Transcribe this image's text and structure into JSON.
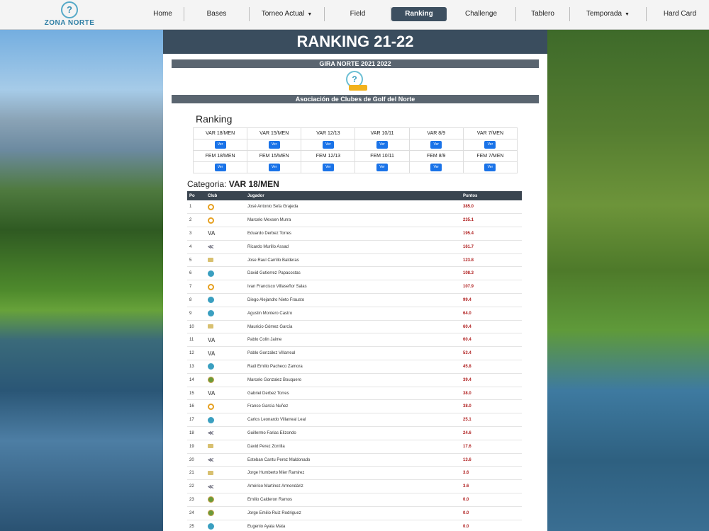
{
  "nav": {
    "logo_text": "ZONA NORTE",
    "items": [
      {
        "label": "Home",
        "dropdown": false,
        "active": false
      },
      {
        "label": "Bases",
        "dropdown": false,
        "active": false
      },
      {
        "label": "Torneo Actual",
        "dropdown": true,
        "active": false
      },
      {
        "label": "Field",
        "dropdown": false,
        "active": false
      },
      {
        "label": "Ranking",
        "dropdown": false,
        "active": true
      },
      {
        "label": "Challenge",
        "dropdown": false,
        "active": false
      },
      {
        "label": "Tablero",
        "dropdown": false,
        "active": false
      },
      {
        "label": "Temporada",
        "dropdown": true,
        "active": false
      },
      {
        "label": "Hard Card",
        "dropdown": false,
        "active": false
      }
    ]
  },
  "page": {
    "title": "RANKING 21-22",
    "subtitle": "GIRA NORTE 2021 2022",
    "association": "Asociación de Clubes de Golf del Norte",
    "ranking_heading": "Ranking",
    "button_label": "Ver"
  },
  "categories": [
    [
      "VAR 18/MEN",
      "VAR 15/MEN",
      "VAR 12/13",
      "VAR 10/11",
      "VAR 8/9",
      "VAR 7/MEN"
    ],
    [
      "FEM 18/MEN",
      "FEM 15/MEN",
      "FEM 12/13",
      "FEM 10/11",
      "FEM 8/9",
      "FEM 7/MEN"
    ]
  ],
  "category": {
    "label": "Categoria:",
    "value": "VAR 18/MEN"
  },
  "table": {
    "headers": [
      "Po",
      "Club",
      "Jugador",
      "Puntos"
    ],
    "rows": [
      {
        "po": "1",
        "club": "o",
        "player": "José Antonio Sefa Grajeda",
        "points": "385.0"
      },
      {
        "po": "2",
        "club": "o",
        "player": "Marcelo Mexsen Murra",
        "points": "235.1"
      },
      {
        "po": "3",
        "club": "v",
        "player": "Eduardo Derbez Torres",
        "points": "195.4"
      },
      {
        "po": "4",
        "club": "k",
        "player": "Ricardo Murillo Assad",
        "points": "161.7"
      },
      {
        "po": "5",
        "club": "y",
        "player": "Jose Raul Carrillo Balderas",
        "points": "123.8"
      },
      {
        "po": "6",
        "club": "b",
        "player": "David Gutierrez Papacostas",
        "points": "108.3"
      },
      {
        "po": "7",
        "club": "o",
        "player": "Ivan Francisco Villaseñor Salas",
        "points": "107.9"
      },
      {
        "po": "8",
        "club": "b",
        "player": "Diego Alejandro Nieto Frausto",
        "points": "99.4"
      },
      {
        "po": "9",
        "club": "b",
        "player": "Agustin Montero Castro",
        "points": "64.0"
      },
      {
        "po": "10",
        "club": "y",
        "player": "Mauricio Gómez García",
        "points": "60.4"
      },
      {
        "po": "11",
        "club": "v",
        "player": "Pablo Colin Jaime",
        "points": "60.4"
      },
      {
        "po": "12",
        "club": "v",
        "player": "Pablo González Villarreal",
        "points": "53.4"
      },
      {
        "po": "13",
        "club": "b",
        "player": "Raúl Emilio Pacheco Zamora",
        "points": "45.8"
      },
      {
        "po": "14",
        "club": "g",
        "player": "Marcelo Gonzalez Bouquero",
        "points": "39.4"
      },
      {
        "po": "15",
        "club": "v",
        "player": "Gabriel Derbez Torres",
        "points": "38.0"
      },
      {
        "po": "16",
        "club": "o",
        "player": "Franco García Nuñez",
        "points": "38.0"
      },
      {
        "po": "17",
        "club": "b",
        "player": "Carlos Leonardo Villarreal Leal",
        "points": "25.1"
      },
      {
        "po": "18",
        "club": "k",
        "player": "Guillermo Farias Elizondo",
        "points": "24.6"
      },
      {
        "po": "19",
        "club": "y",
        "player": "David Perez Zorrilla",
        "points": "17.6"
      },
      {
        "po": "20",
        "club": "k",
        "player": "Esteban Cantu Perez Maldonado",
        "points": "13.6"
      },
      {
        "po": "21",
        "club": "y",
        "player": "Jorge Humberto Mier Ramirez",
        "points": "3.6"
      },
      {
        "po": "22",
        "club": "k",
        "player": "Américo Martinez Armendáriz",
        "points": "3.6"
      },
      {
        "po": "23",
        "club": "g",
        "player": "Emilio Calderon Ramos",
        "points": "0.0"
      },
      {
        "po": "24",
        "club": "g",
        "player": "Jorge Emilio Ruiz Rodriguez",
        "points": "0.0"
      },
      {
        "po": "25",
        "club": "b",
        "player": "Eugenio Ayala Mata",
        "points": "0.0"
      }
    ]
  },
  "colors": {
    "header_bar": "#3a4d5e",
    "button": "#1a73e8",
    "points": "#b02020"
  }
}
